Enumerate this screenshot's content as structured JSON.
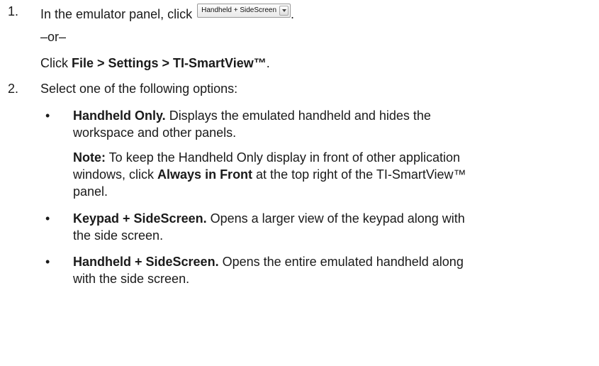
{
  "step1": {
    "number": "1.",
    "prefix": "In the emulator panel, click ",
    "dropdown_label": "Handheld + SideScreen",
    "suffix": ".",
    "or": "–or–",
    "click": "Click ",
    "menu_path": "File > Settings > TI-SmartView™",
    "menu_suffix": "."
  },
  "step2": {
    "number": "2.",
    "text": "Select one of the following options:",
    "bullets": [
      {
        "symbol": "•",
        "term": "Handheld Only.",
        "desc_line1": " Displays the emulated handheld and hides the",
        "desc_line2": "workspace and other panels.",
        "note": {
          "label": "Note:",
          "line1": " To keep the Handheld Only display in front of other application",
          "line2_prefix": "windows, click ",
          "line2_bold": "Always in Front",
          "line2_suffix": " at the top right of the TI-SmartView™",
          "line3": "panel."
        }
      },
      {
        "symbol": "•",
        "term": "Keypad + SideScreen.",
        "desc_line1": " Opens a larger view of the keypad along with",
        "desc_line2": "the side screen."
      },
      {
        "symbol": "•",
        "term": "Handheld + SideScreen.",
        "desc_line1": " Opens the entire emulated handheld along",
        "desc_line2": "with the side screen."
      }
    ]
  }
}
